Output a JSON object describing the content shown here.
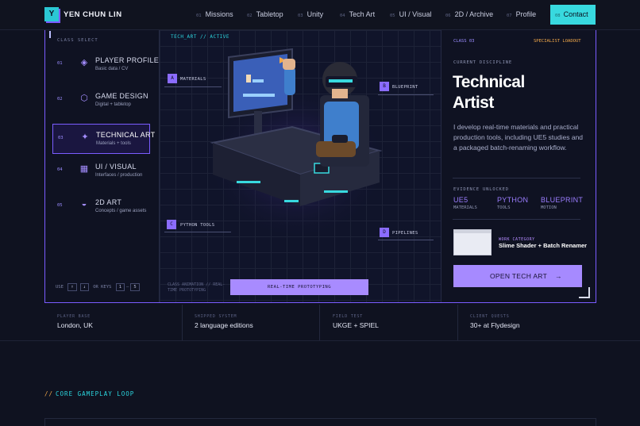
{
  "brand": {
    "logo_letter": "Y",
    "name": "YEN CHUN LIN"
  },
  "nav": [
    {
      "num": "01",
      "label": "Missions"
    },
    {
      "num": "02",
      "label": "Tabletop"
    },
    {
      "num": "03",
      "label": "Unity"
    },
    {
      "num": "04",
      "label": "Tech Art"
    },
    {
      "num": "05",
      "label": "UI / Visual"
    },
    {
      "num": "06",
      "label": "2D / Archive"
    },
    {
      "num": "07",
      "label": "Profile"
    },
    {
      "num": "08",
      "label": "Contact"
    }
  ],
  "class_select": {
    "heading": "CLASS SELECT",
    "items": [
      {
        "num": "01",
        "title": "PLAYER PROFILE",
        "sub": "Basic data / CV",
        "icon": "diamond-icon"
      },
      {
        "num": "02",
        "title": "GAME DESIGN",
        "sub": "Digital + tabletop",
        "icon": "hexagon-icon"
      },
      {
        "num": "03",
        "title": "TECHNICAL ART",
        "sub": "Materials + tools",
        "icon": "sparkle-icon"
      },
      {
        "num": "04",
        "title": "UI / VISUAL",
        "sub": "Interfaces / production",
        "icon": "grid-icon"
      },
      {
        "num": "05",
        "title": "2D ART",
        "sub": "Concepts / game assets",
        "icon": "half-circle-icon"
      }
    ],
    "keys": {
      "use": "USE",
      "k1": "↑",
      "k2": "↓",
      "or": "OR KEYS",
      "k3": "1",
      "k4": "5"
    }
  },
  "center": {
    "tag": "TECH_ART // ACTIVE",
    "markers": [
      {
        "letter": "A",
        "label": "MATERIALS"
      },
      {
        "letter": "B",
        "label": "BLUEPRINT"
      },
      {
        "letter": "C",
        "label": "PYTHON TOOLS"
      },
      {
        "letter": "D",
        "label": "PIPELINES"
      }
    ],
    "anim_label": "CLASS ANIMATION // REAL-TIME PROTOTYPING",
    "button": "REAL-TIME PROTOTYPING"
  },
  "detail": {
    "class_num": "CLASS 03",
    "loadout": "SPECIALIST LOADOUT",
    "discipline_label": "CURRENT DISCIPLINE",
    "title_line1": "Technical",
    "title_line2": "Artist",
    "description": "I develop real-time materials and practical production tools, including UE5 studies and a packaged batch-renaming workflow.",
    "evidence_label": "EVIDENCE UNLOCKED",
    "evidence": [
      {
        "value": "UE5",
        "label": "MATERIALS"
      },
      {
        "value": "PYTHON",
        "label": "TOOLS"
      },
      {
        "value": "BLUEPRINT",
        "label": "MOTION"
      }
    ],
    "work_category": "WORK CATEGORY",
    "work_title": "Slime Shader + Batch Renamer",
    "open_button": "OPEN TECH ART",
    "open_arrow": "→"
  },
  "stats": [
    {
      "key": "PLAYER BASE",
      "value": "London, UK"
    },
    {
      "key": "SHIPPED SYSTEM",
      "value": "2 language editions"
    },
    {
      "key": "FIELD TEST",
      "value": "UKGE + SPIEL"
    },
    {
      "key": "CLIENT QUESTS",
      "value": "30+ at Flydesign"
    }
  ],
  "section": {
    "slashes": "//",
    "title": "CORE GAMEPLAY LOOP"
  },
  "colors": {
    "accent_purple": "#a68aff",
    "accent_cyan": "#38d9df",
    "accent_orange": "#f3a94a",
    "background": "#0f1220"
  }
}
